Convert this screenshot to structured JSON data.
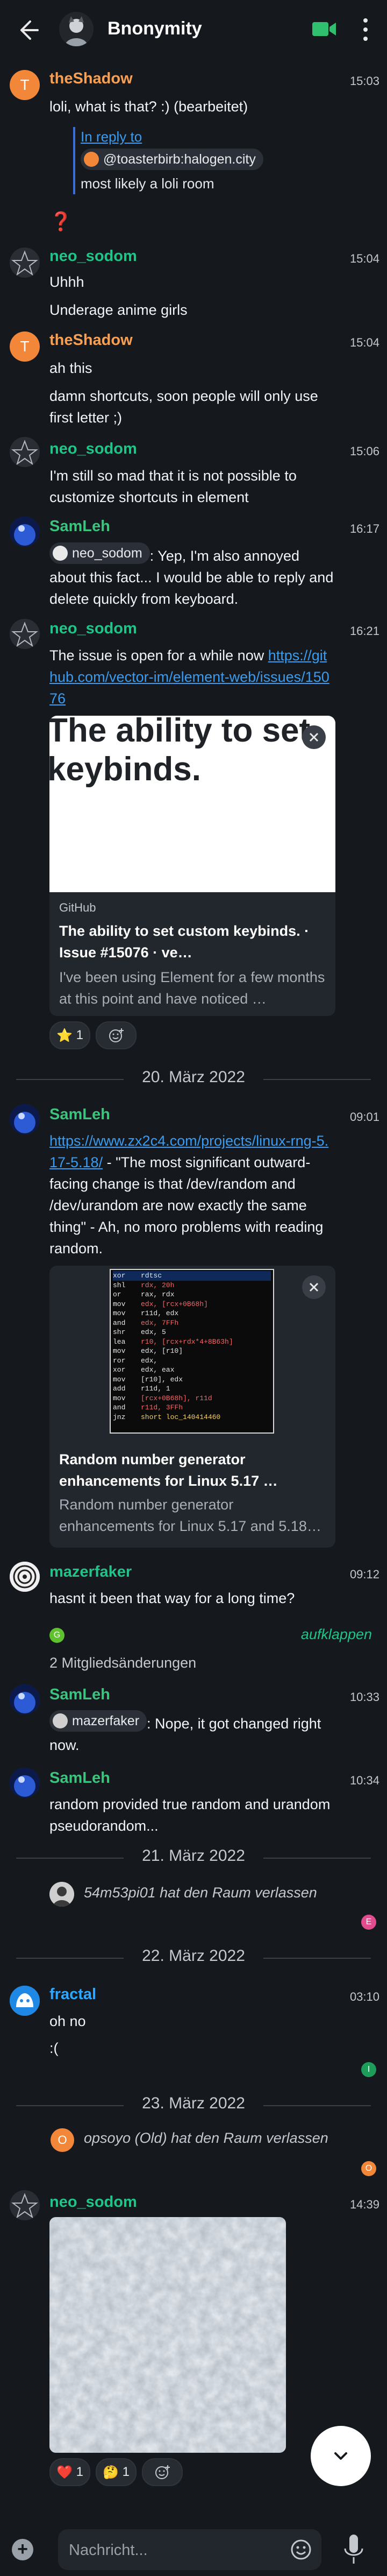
{
  "header": {
    "title": "Bnonymity"
  },
  "messages": {
    "m1": {
      "initial": "T",
      "sender": "theShadow",
      "time": "15:03",
      "text": "loli, what is that? :) (bearbeitet)"
    },
    "m2": {
      "reply_label": "In reply to",
      "reply_to": "@toasterbirb:halogen.city",
      "reply_text": "most likely a loli room",
      "emoji": "❓"
    },
    "m3": {
      "sender": "neo_sodom",
      "time": "15:04",
      "line1": "Uhhh",
      "line2": "Underage anime girls"
    },
    "m4": {
      "initial": "T",
      "sender": "theShadow",
      "time": "15:04",
      "line1": "ah this",
      "line2": "damn shortcuts, soon people will only use first letter ;)"
    },
    "m5": {
      "sender": "neo_sodom",
      "time": "15:06",
      "text": "I'm still so mad that it is not possible to customize shortcuts in element"
    },
    "m6": {
      "sender": "SamLeh",
      "time": "16:17",
      "mention": "neo_sodom",
      "text": ": Yep, I'm also annoyed about this fact... I would be able to reply and delete quickly from keyboard."
    },
    "m7": {
      "sender": "neo_sodom",
      "time": "16:21",
      "text": "The issue is open for a while now ",
      "link": "https://github.com/vector-im/element-web/issues/15076",
      "card": {
        "image_text": "The ability to set keybinds.",
        "site": "GitHub",
        "title": "The ability to set custom keybinds. · Issue #15076 · ve…",
        "desc": "I've been using Element for a few months at this point and have noticed …"
      },
      "reactions": [
        {
          "emoji": "⭐",
          "count": "1"
        }
      ]
    },
    "m8": {
      "sender": "SamLeh",
      "time": "09:01",
      "link": "https://www.zx2c4.com/projects/linux-rng-5.17-5.18/",
      "text": " - \"The most significant outward-facing change is that /dev/random and /dev/urandom are now exactly the same thing\" - Ah, no moro problems with reading random.",
      "card": {
        "site": "",
        "title": "Random number generator enhancements for Linux 5.17 …",
        "desc": "Random number generator enhancements for Linux 5.17 and 5.18…"
      }
    },
    "m9": {
      "sender": "mazerfaker",
      "time": "09:12",
      "text": "hasnt it been that way for a long time?"
    },
    "m10": {
      "initial": "G",
      "expand": "aufklappen",
      "members": "2 Mitgliedsänderungen"
    },
    "m11": {
      "sender": "SamLeh",
      "time": "10:33",
      "mention": "mazerfaker",
      "text": ": Nope, it got changed right now."
    },
    "m12": {
      "sender": "SamLeh",
      "time": "10:34",
      "text": "random provided true random and urandom pseudorandom..."
    },
    "m13": {
      "text": "54m53pi01 hat den Raum verlassen",
      "marker": "E"
    },
    "m14": {
      "sender": "fractal",
      "time": "03:10",
      "line1": "oh no",
      "line2": ":(",
      "marker": "I"
    },
    "m15": {
      "initial": "O",
      "text": "opsoyo (Old) hat den Raum verlassen",
      "marker": "O"
    },
    "m16": {
      "sender": "neo_sodom",
      "time": "14:39",
      "reactions": [
        {
          "emoji": "❤️",
          "count": "1"
        },
        {
          "emoji": "🤔",
          "count": "1"
        }
      ]
    }
  },
  "dates": {
    "d1": "20. März 2022",
    "d2": "21. März 2022",
    "d3": "22. März 2022",
    "d4": "23. März 2022"
  },
  "disasm": [
    [
      "xor",
      "rdtsc",
      ""
    ],
    [
      "shl",
      "rdx, 20h",
      ""
    ],
    [
      "or",
      "rax, rdx",
      ""
    ],
    [
      "mov",
      "edx, [rcx+0B68h]",
      ""
    ],
    [
      "mov",
      "r11d, edx",
      ""
    ],
    [
      "and",
      "edx, 7FFh",
      ""
    ],
    [
      "shr",
      "edx, 5",
      ""
    ],
    [
      "lea",
      "r10, [rcx+rdx*4+8B63h]",
      ""
    ],
    [
      "mov",
      "edx, [r10]",
      ""
    ],
    [
      "ror",
      "edx, ",
      ""
    ],
    [
      "xor",
      "edx, eax",
      ""
    ],
    [
      "mov",
      "[r10], edx",
      ""
    ],
    [
      "add",
      "r11d, 1",
      ""
    ],
    [
      "mov",
      "[rcx+0B68h], r11d",
      ""
    ],
    [
      "and",
      "r11d, 3FFh",
      ""
    ],
    [
      "jnz",
      "short loc_140414460",
      ""
    ]
  ],
  "composer": {
    "placeholder": "Nachricht..."
  },
  "colors": {
    "accent": "#21c488",
    "link": "#3a9cf0",
    "background": "#15191e"
  }
}
